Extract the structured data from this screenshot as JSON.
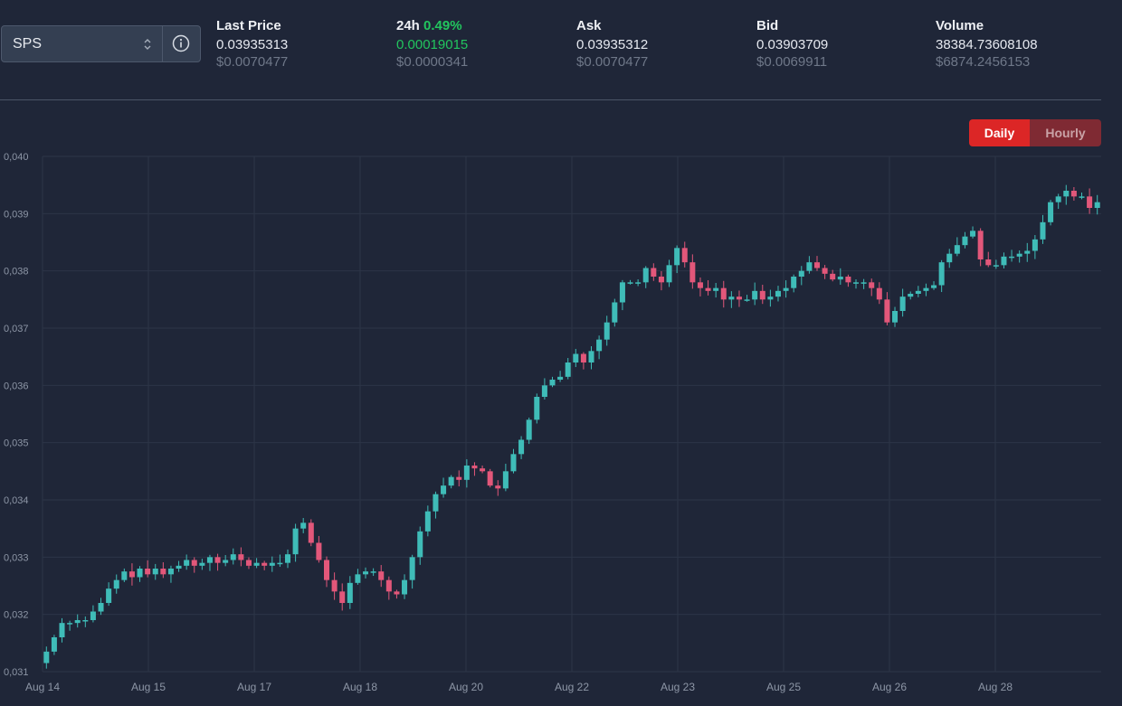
{
  "token_selector": {
    "value": "SPS",
    "arrows_icon": "chevron-up-down-icon",
    "info_icon": "info-circle-icon"
  },
  "stats": [
    {
      "label": "Last Price",
      "value": "0.03935313",
      "usd": "$0.0070477"
    },
    {
      "label": "24h",
      "label_change": "0.49%",
      "value": "0.00019015",
      "usd": "$0.0000341",
      "positive": true
    },
    {
      "label": "Ask",
      "value": "0.03935312",
      "usd": "$0.0070477"
    },
    {
      "label": "Bid",
      "value": "0.03903709",
      "usd": "$0.0069911"
    },
    {
      "label": "Volume",
      "value": "38384.73608108",
      "usd": "$6874.2456153"
    }
  ],
  "interval_toggle": {
    "daily": "Daily",
    "hourly": "Hourly",
    "active": "daily"
  },
  "colors": {
    "background": "#1f2638",
    "up": "#3fbcb8",
    "down": "#e2577a",
    "grid": "#2c3547",
    "accent": "#dc2626",
    "positive": "#22c55e"
  },
  "chart_data": {
    "type": "candlestick",
    "ylim": [
      0.031,
      0.04
    ],
    "y_ticks": [
      "0,031",
      "0,032",
      "0,033",
      "0,034",
      "0,035",
      "0,036",
      "0,037",
      "0,038",
      "0,039",
      "0,040"
    ],
    "x_ticks": [
      "Aug 14",
      "Aug 15",
      "Aug 17",
      "Aug 18",
      "Aug 20",
      "Aug 22",
      "Aug 23",
      "Aug 25",
      "Aug 26",
      "Aug 28"
    ],
    "grid": true,
    "close_series": [
      0.03135,
      0.0316,
      0.03185,
      0.03185,
      0.0319,
      0.0319,
      0.03205,
      0.0322,
      0.03245,
      0.0326,
      0.03275,
      0.03265,
      0.0328,
      0.0327,
      0.0328,
      0.0327,
      0.0328,
      0.03285,
      0.03295,
      0.03285,
      0.0329,
      0.033,
      0.0329,
      0.03295,
      0.03305,
      0.03295,
      0.03285,
      0.0329,
      0.03285,
      0.0329,
      0.0329,
      0.03305,
      0.0335,
      0.0336,
      0.03325,
      0.03295,
      0.0326,
      0.0324,
      0.0322,
      0.03255,
      0.0327,
      0.03275,
      0.03275,
      0.0326,
      0.0324,
      0.03235,
      0.0326,
      0.033,
      0.03345,
      0.0338,
      0.0341,
      0.03425,
      0.0344,
      0.03435,
      0.0346,
      0.03455,
      0.0345,
      0.03425,
      0.0342,
      0.0345,
      0.0348,
      0.03505,
      0.0354,
      0.0358,
      0.036,
      0.0361,
      0.03615,
      0.0364,
      0.03655,
      0.0364,
      0.0366,
      0.0368,
      0.0371,
      0.03745,
      0.0378,
      0.0378,
      0.0378,
      0.03805,
      0.0379,
      0.0378,
      0.0381,
      0.0384,
      0.03815,
      0.0378,
      0.0377,
      0.03765,
      0.0377,
      0.0375,
      0.03755,
      0.0375,
      0.0375,
      0.03765,
      0.0375,
      0.03755,
      0.03765,
      0.0377,
      0.0379,
      0.038,
      0.03815,
      0.03805,
      0.03795,
      0.03785,
      0.0379,
      0.0378,
      0.0378,
      0.0378,
      0.0377,
      0.0375,
      0.0371,
      0.0373,
      0.03755,
      0.0376,
      0.03765,
      0.0377,
      0.03775,
      0.03815,
      0.0383,
      0.03845,
      0.0386,
      0.0387,
      0.0382,
      0.0381,
      0.0381,
      0.03825,
      0.03825,
      0.0383,
      0.03835,
      0.03855,
      0.03885,
      0.0392,
      0.0393,
      0.0394,
      0.0393,
      0.0393,
      0.0391,
      0.0392
    ]
  }
}
